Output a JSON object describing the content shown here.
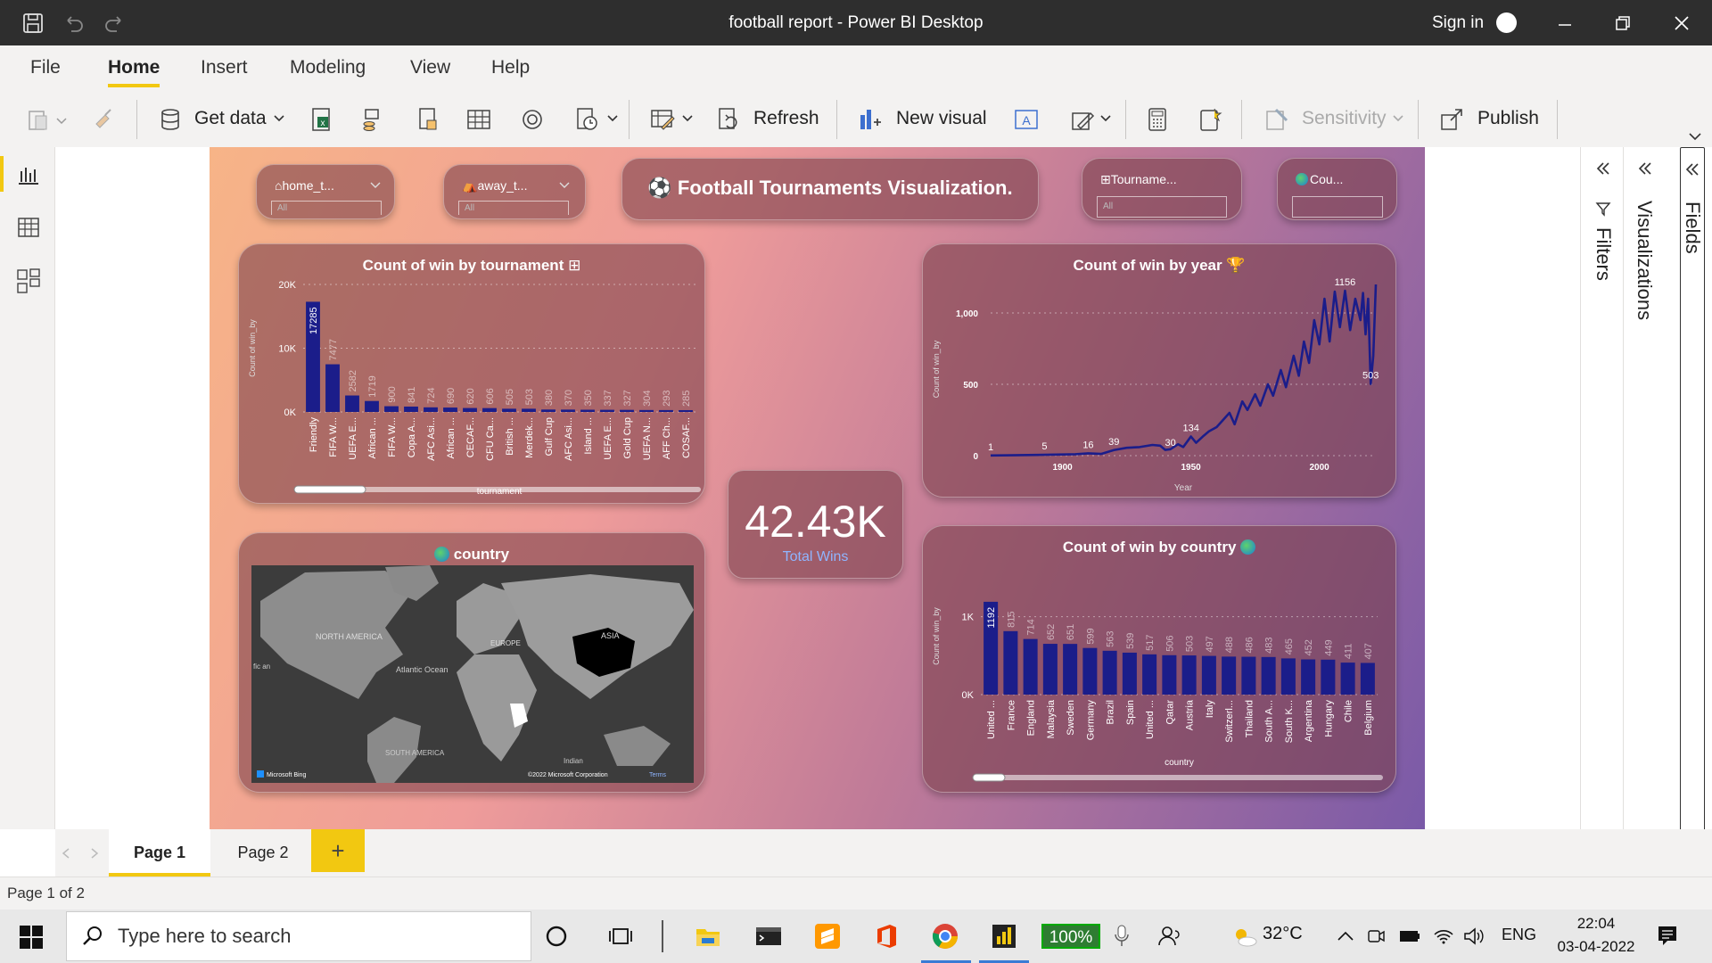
{
  "window": {
    "title": "football report - Power BI Desktop",
    "sign_in": "Sign in"
  },
  "menu": {
    "items": [
      "File",
      "Home",
      "Insert",
      "Modeling",
      "View",
      "Help"
    ],
    "active": "Home"
  },
  "ribbon": {
    "get_data": "Get data",
    "refresh": "Refresh",
    "new_visual": "New visual",
    "sensitivity": "Sensitivity",
    "publish": "Publish"
  },
  "slicers": {
    "home_team": {
      "label": "home_t...",
      "value": "All",
      "icon": "house-icon"
    },
    "away_team": {
      "label": "away_t...",
      "value": "All",
      "icon": "tent-icon"
    },
    "tournament": {
      "label": "Tourname...",
      "value": "All",
      "icon": "goal-icon"
    },
    "country": {
      "label": "Cou...",
      "value": "",
      "icon": "globe-icon"
    }
  },
  "banner": {
    "title": "Football Tournaments Visualization.",
    "icon": "soccer-ball-icon"
  },
  "kpi": {
    "value": "42.43K",
    "label": "Total Wins"
  },
  "map": {
    "title": "country",
    "labels": [
      "NORTH AMERICA",
      "EUROPE",
      "ASIA",
      "Atlantic Ocean",
      "SOUTH AMERICA",
      "Indian",
      "fic an"
    ],
    "attribution": "Microsoft Bing",
    "copyright": "©2022 Microsoft Corporation",
    "terms": "Terms"
  },
  "pages": {
    "tabs": [
      "Page 1",
      "Page 2"
    ],
    "active": "Page 1",
    "add": "+"
  },
  "status": {
    "text": "Page 1 of 2"
  },
  "panes": {
    "filters": "Filters",
    "visualizations": "Visualizations",
    "fields": "Fields"
  },
  "taskbar": {
    "search_placeholder": "Type here to search",
    "battery": "100%",
    "temperature": "32°C",
    "language": "ENG",
    "time": "22:04",
    "date": "03-04-2022"
  },
  "colors": {
    "bar": "#1b1d8a",
    "accent": "#f2c811",
    "titlebar": "#2e2e2e"
  },
  "chart_data": [
    {
      "type": "bar",
      "title": "Count of win by tournament",
      "xlabel": "tournament",
      "ylabel": "Count of win_by",
      "ylim": [
        0,
        20000
      ],
      "yticks": [
        "0K",
        "10K",
        "20K"
      ],
      "categories": [
        "Friendly",
        "FIFA W...",
        "UEFA E...",
        "African ...",
        "FIFA W...",
        "Copa A...",
        "AFC Asi...",
        "African ...",
        "CECAF...",
        "CFU Ca...",
        "British ...",
        "Merdek...",
        "Gulf Cup",
        "AFC Asi...",
        "Island ...",
        "UEFA E...",
        "Gold Cup",
        "UEFA N...",
        "AFF Ch...",
        "COSAF..."
      ],
      "values": [
        17285,
        7477,
        2582,
        1719,
        900,
        841,
        724,
        690,
        620,
        606,
        505,
        503,
        380,
        370,
        350,
        337,
        327,
        304,
        293,
        285
      ],
      "value_labels": [
        "17285",
        "7477",
        "2582",
        "1719",
        "900",
        "841",
        "724",
        "690",
        "620",
        "606",
        "505",
        "503",
        "380",
        "370",
        "350",
        "337",
        "327",
        "304",
        "293",
        "285"
      ]
    },
    {
      "type": "line",
      "title": "Count of win by year",
      "xlabel": "Year",
      "ylabel": "Count of win_by",
      "xlim": [
        1872,
        2022
      ],
      "ylim": [
        0,
        1200
      ],
      "xticks": [
        "1900",
        "1950",
        "2000"
      ],
      "yticks": [
        "0",
        "500",
        "1,000"
      ],
      "x": [
        1872,
        1880,
        1890,
        1900,
        1905,
        1910,
        1915,
        1920,
        1925,
        1930,
        1935,
        1938,
        1940,
        1942,
        1945,
        1947,
        1950,
        1952,
        1955,
        1957,
        1960,
        1962,
        1965,
        1967,
        1970,
        1972,
        1975,
        1977,
        1980,
        1982,
        1985,
        1987,
        1990,
        1992,
        1994,
        1996,
        1998,
        2000,
        2002,
        2004,
        2006,
        2008,
        2010,
        2012,
        2014,
        2016,
        2017,
        2018,
        2019,
        2020,
        2021,
        2022
      ],
      "y": [
        1,
        3,
        5,
        8,
        10,
        16,
        12,
        39,
        55,
        60,
        75,
        70,
        40,
        45,
        80,
        60,
        134,
        90,
        140,
        170,
        200,
        240,
        300,
        220,
        380,
        320,
        430,
        350,
        500,
        420,
        600,
        480,
        700,
        560,
        800,
        650,
        950,
        780,
        1100,
        800,
        1150,
        900,
        1156,
        880,
        1100,
        950,
        1140,
        850,
        1100,
        503,
        700,
        1200
      ],
      "point_labels": [
        {
          "x": 1872,
          "y": 1,
          "text": "1"
        },
        {
          "x": 1893,
          "y": 5,
          "text": "5"
        },
        {
          "x": 1920,
          "y": 39,
          "text": "39"
        },
        {
          "x": 1910,
          "y": 16,
          "text": "16"
        },
        {
          "x": 1950,
          "y": 134,
          "text": "134"
        },
        {
          "x": 1942,
          "y": 30,
          "text": "30"
        },
        {
          "x": 2010,
          "y": 1156,
          "text": "1156"
        },
        {
          "x": 2020,
          "y": 503,
          "text": "503"
        }
      ]
    },
    {
      "type": "bar",
      "title": "Count of win by country",
      "xlabel": "country",
      "ylabel": "Count of win_by",
      "ylim": [
        0,
        1500
      ],
      "yticks": [
        "0K",
        "1K"
      ],
      "categories": [
        "United ...",
        "France",
        "England",
        "Malaysia",
        "Sweden",
        "Germany",
        "Brazil",
        "Spain",
        "United ...",
        "Qatar",
        "Austria",
        "Italy",
        "Switzerl...",
        "Thailand",
        "South A...",
        "South K...",
        "Argentina",
        "Hungary",
        "Chile",
        "Belgium"
      ],
      "values": [
        1192,
        815,
        714,
        652,
        651,
        599,
        563,
        539,
        517,
        506,
        503,
        497,
        488,
        486,
        483,
        465,
        452,
        449,
        411,
        407
      ],
      "value_labels": [
        "1192",
        "815",
        "714",
        "652",
        "651",
        "599",
        "563",
        "539",
        "517",
        "506",
        "503",
        "497",
        "488",
        "486",
        "483",
        "465",
        "452",
        "449",
        "411",
        "407"
      ]
    }
  ]
}
